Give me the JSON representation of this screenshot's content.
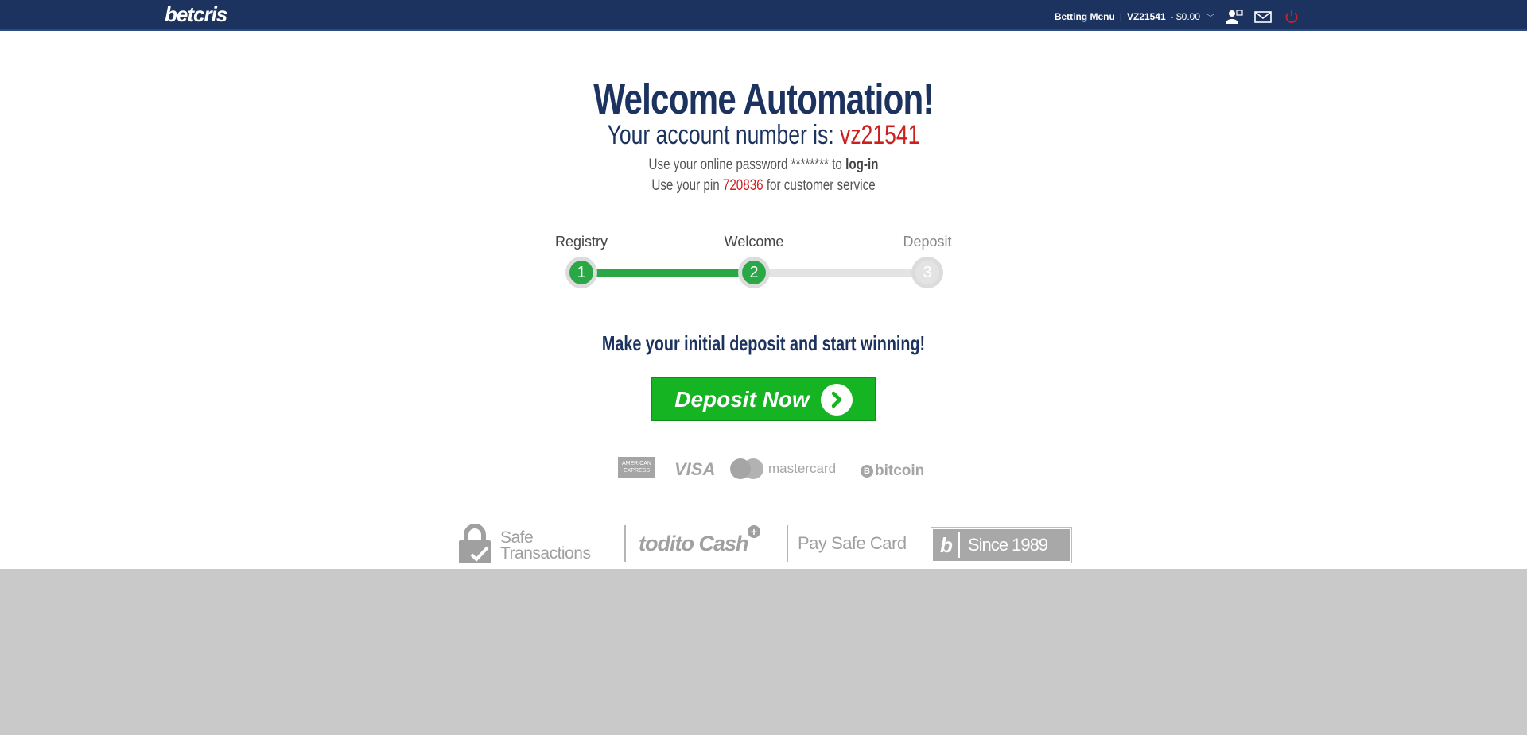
{
  "header": {
    "logo": "betcris",
    "betting_menu": "Betting Menu",
    "separator": "|",
    "account": "VZ21541",
    "balance": "- $0.00",
    "chevron": "﹀"
  },
  "welcome": {
    "title": "Welcome Automation!",
    "account_prefix": "Your account number is:",
    "account_number": "vz21541",
    "password_line_pre": "Use your online password ******** to",
    "password_line_link": "log-in",
    "pin_line_pre": "Use your pin",
    "pin": "720836",
    "pin_line_post": "for customer service"
  },
  "stepper": {
    "steps": [
      {
        "label": "Registry",
        "number": "1"
      },
      {
        "label": "Welcome",
        "number": "2"
      },
      {
        "label": "Deposit",
        "number": "3"
      }
    ],
    "current_step": 2
  },
  "cta": {
    "text": "Make your initial deposit and start winning!",
    "button_label": "Deposit Now"
  },
  "payments": {
    "amex_line1": "AMERICAN",
    "amex_line2": "EXPRESS",
    "visa": "VISA",
    "mastercard": "mastercard",
    "bitcoin": "bitcoin",
    "bitcoin_symbol": "B"
  },
  "trust": {
    "safe_line1": "Safe",
    "safe_line2": "Transactions",
    "todito": "todito Cash",
    "todito_plus": "+",
    "paysafe": "Pay Safe Card",
    "since_letter": "b",
    "since": "Since 1989"
  },
  "colors": {
    "navy": "#1c3360",
    "green": "#2aa845",
    "deposit_green": "#15b422",
    "red": "#cc1f1f",
    "footer_gray": "#c9c9c9"
  }
}
